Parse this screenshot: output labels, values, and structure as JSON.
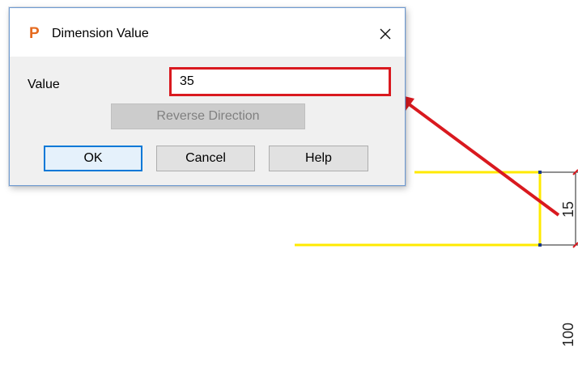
{
  "dialog": {
    "title": "Dimension Value",
    "app_logo": "P",
    "close_icon": "×",
    "value_label": "Value",
    "value": "35",
    "buttons": {
      "reverse_direction": "Reverse Direction",
      "ok": "OK",
      "cancel": "Cancel",
      "help": "Help"
    }
  },
  "drawing": {
    "dimension_short": "15",
    "dimension_long": "100",
    "highlight_color": "#ffea00",
    "annotation_color": "#d9191f"
  }
}
